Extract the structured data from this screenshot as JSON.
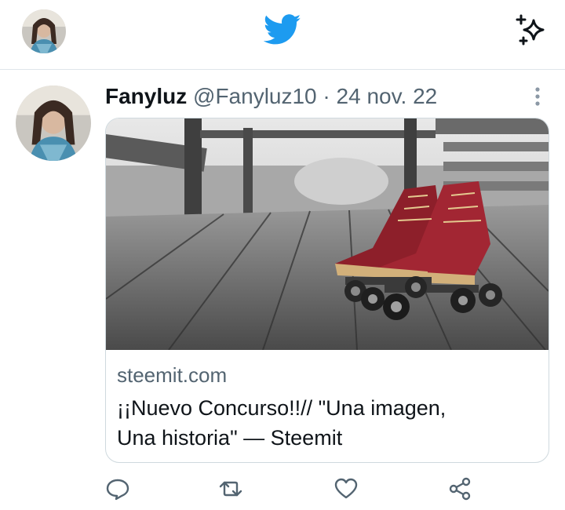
{
  "topbar": {
    "avatar_icon": "profile-avatar-icon",
    "logo_icon": "twitter-bird-icon",
    "logo_color": "#1d9bf0",
    "sparkle_icon": "sparkle-icon"
  },
  "tweet": {
    "author_name": "Fanyluz",
    "author_handle": "@Fanyluz10",
    "separator": "·",
    "date": "24 nov. 22",
    "more_icon": "more-vertical-icon",
    "card": {
      "image_description_icon": "roller-skates-photo",
      "domain": "steemit.com",
      "title_line1": "¡¡Nuevo Concurso!!// \"Una imagen,",
      "title_line2": "Una historia\" — Steemit"
    },
    "actions": [
      "reply-icon",
      "retweet-icon",
      "like-icon",
      "share-icon"
    ]
  },
  "colors": {
    "text_primary": "#0f1419",
    "text_secondary": "#536471",
    "border": "#cfd9de",
    "accent": "#1d9bf0"
  }
}
